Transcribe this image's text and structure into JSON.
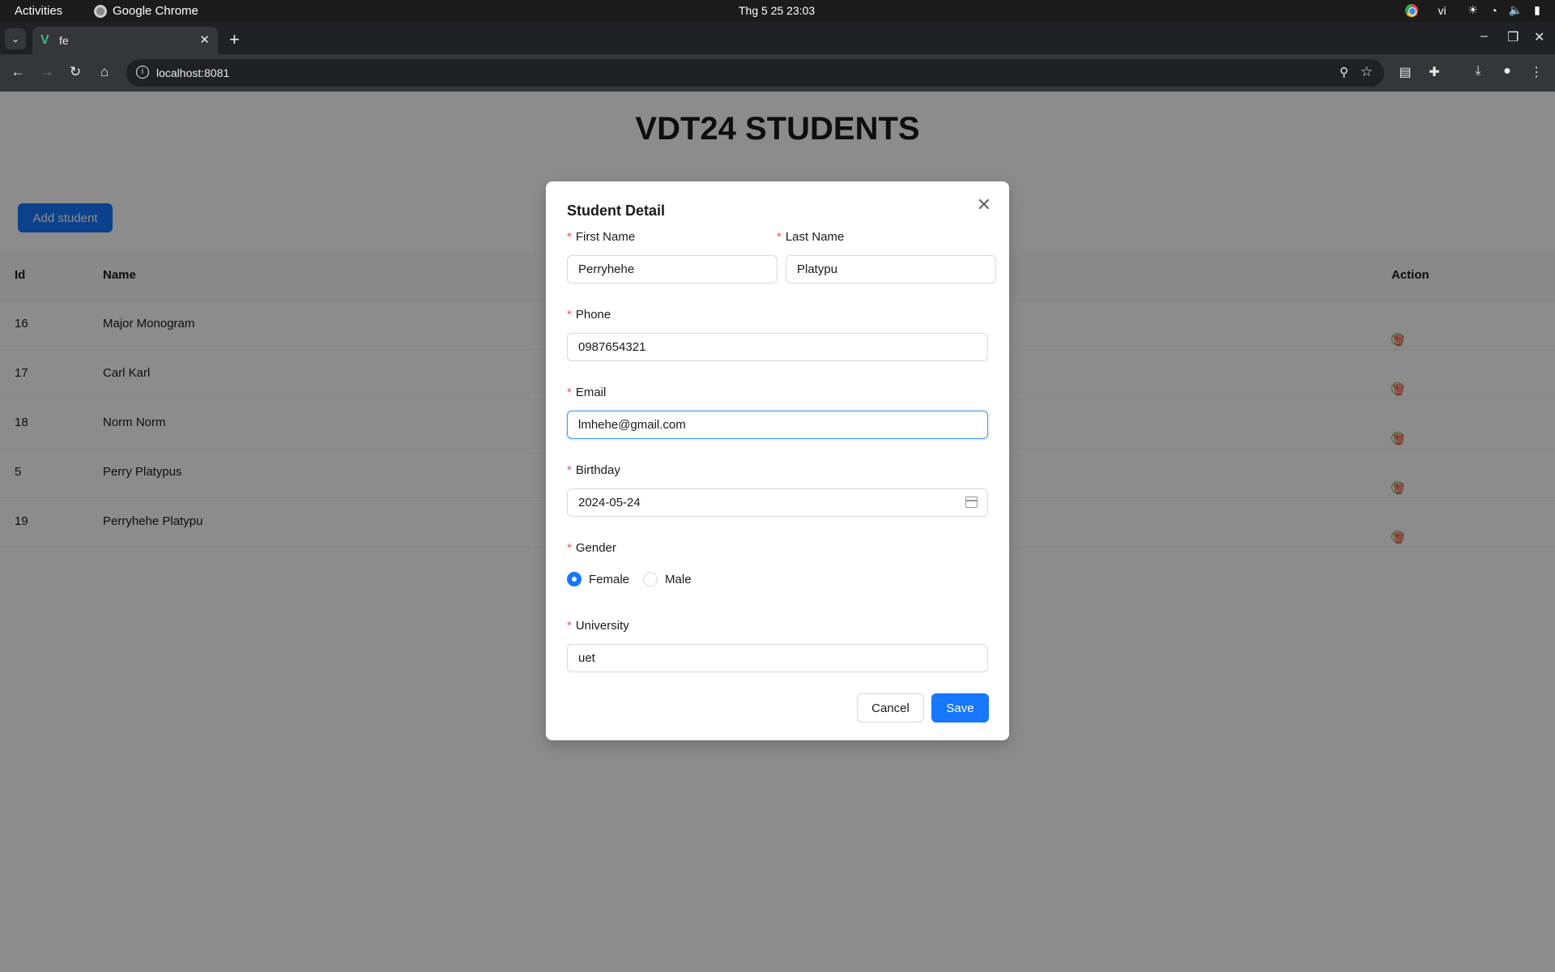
{
  "system": {
    "activities": "Activities",
    "app_name": "Google Chrome",
    "clock": "Thg 5 25  23:03",
    "input_method": "vi"
  },
  "browser": {
    "tab_title": "fe",
    "url": "localhost:8081"
  },
  "page": {
    "title": "VDT24 STUDENTS",
    "add_button": "Add student",
    "columns": {
      "id": "Id",
      "name": "Name",
      "action": "Action"
    },
    "rows": [
      {
        "id": "16",
        "name": "Major Monogram"
      },
      {
        "id": "17",
        "name": "Carl Karl"
      },
      {
        "id": "18",
        "name": "Norm Norm"
      },
      {
        "id": "5",
        "name": "Perry Platypus"
      },
      {
        "id": "19",
        "name": "Perryhehe Platypu"
      }
    ]
  },
  "modal": {
    "title": "Student Detail",
    "required_mark": "*",
    "first_name": {
      "label": "First Name",
      "value": "Perryhehe"
    },
    "last_name": {
      "label": "Last Name",
      "value": "Platypu"
    },
    "phone": {
      "label": "Phone",
      "value": "0987654321"
    },
    "email": {
      "label": "Email",
      "value": "lmhehe@gmail.com"
    },
    "birthday": {
      "label": "Birthday",
      "value": "2024-05-24"
    },
    "gender": {
      "label": "Gender",
      "options": [
        "Female",
        "Male"
      ],
      "selected": "Female"
    },
    "university": {
      "label": "University",
      "value": "uet"
    },
    "cancel": "Cancel",
    "save": "Save"
  },
  "colors": {
    "primary": "#1677ff",
    "required": "#ff4d4f",
    "info_action": "#52c41a",
    "edit_action": "#faad14",
    "delete_action": "#ff4d4f"
  }
}
